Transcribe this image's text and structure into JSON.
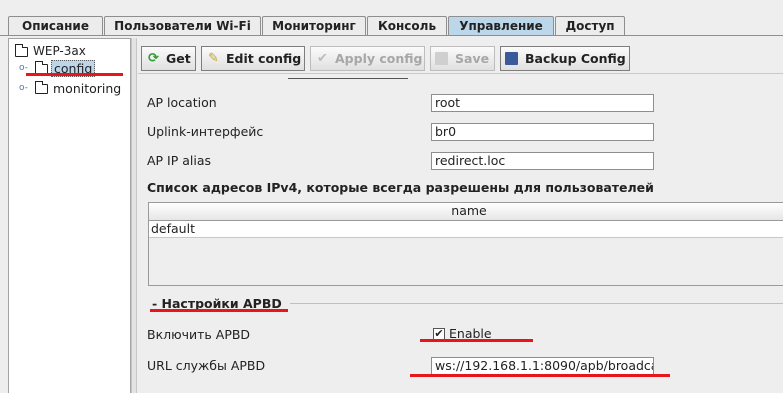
{
  "tabs": [
    "Описание",
    "Пользователи Wi-Fi",
    "Мониторинг",
    "Консоль",
    "Управление",
    "Доступ"
  ],
  "active_tab": "Управление",
  "tree": {
    "root": "WEP-3ax",
    "children": [
      "config",
      "monitoring"
    ],
    "selected": "config"
  },
  "toolbar": {
    "get": "Get",
    "edit": "Edit config",
    "apply": "Apply config",
    "save": "Save",
    "backup": "Backup Config"
  },
  "form": {
    "ap_location_label": "AP location",
    "ap_location_value": "root",
    "uplink_label": "Uplink-интерфейс",
    "uplink_value": "br0",
    "alias_label": "AP IP alias",
    "alias_value": "redirect.loc",
    "ipv4_header": "Список адресов IPv4, которые всегда разрешены для пользователей",
    "table_column": "name",
    "table_rows": [
      "default"
    ],
    "apbd_section": "- Настройки APBD",
    "apbd_enable_label": "Включить APBD",
    "apbd_enable_text": "Enable",
    "apbd_enable_checked": true,
    "apbd_url_label": "URL службы APBD",
    "apbd_url_value": "ws://192.168.1.1:8090/apb/broadca"
  },
  "colors": {
    "active_tab": "#bcd6ea",
    "annotation": "#e8161a"
  }
}
